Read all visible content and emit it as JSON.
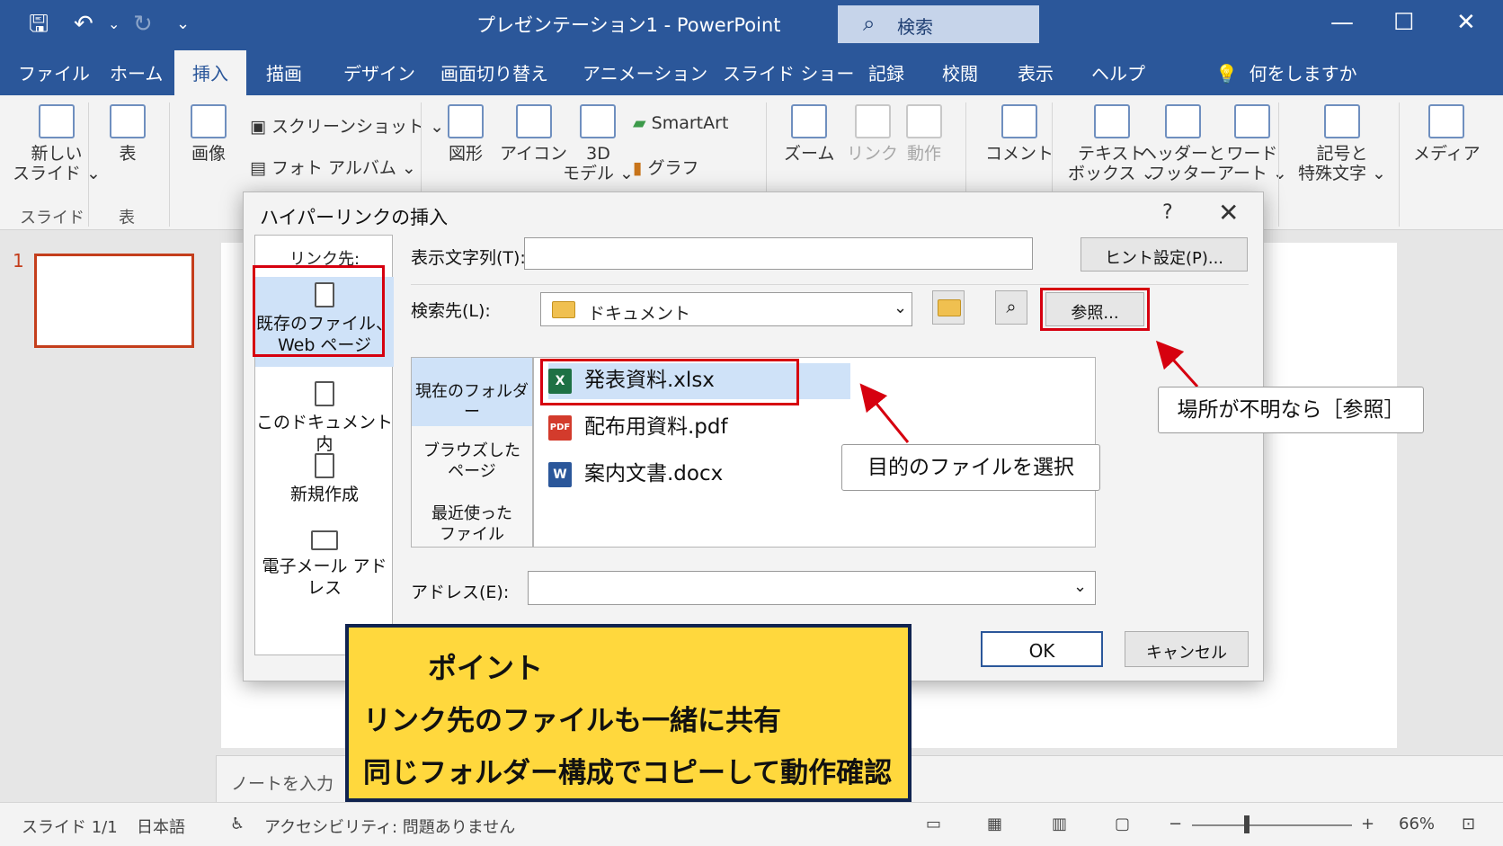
{
  "app": {
    "title": "プレゼンテーション1  -  PowerPoint",
    "search_placeholder": "検索",
    "tell_me": "何をしますか"
  },
  "tabs": [
    "ファイル",
    "ホーム",
    "挿入",
    "描画",
    "デザイン",
    "画面切り替え",
    "アニメーション",
    "スライド ショー",
    "記録",
    "校閲",
    "表示",
    "ヘルプ"
  ],
  "active_tab": "挿入",
  "ribbon": {
    "new_slide": "新しい\nスライド ⌄",
    "table": "表",
    "image": "画像",
    "screenshot": "スクリーンショット ⌄",
    "photo_album": "フォト アルバム  ⌄",
    "shapes": "図形",
    "icons": "アイコン",
    "model3d": "3D\nモデル ⌄",
    "smartart": "SmartArt",
    "graph": "グラフ",
    "zoom": "ズーム",
    "link": "リンク",
    "action": "動作",
    "comment": "コメント",
    "textbox": "テキスト\nボックス ⌄",
    "header_footer": "ヘッダーと\nフッター",
    "wordart": "ワード\nアート ⌄",
    "symbols": "記号と\n特殊文字 ⌄",
    "media": "メディア",
    "groups": {
      "slides": "スライド",
      "tables": "表"
    }
  },
  "slide_pane": {
    "number": "1"
  },
  "notes_placeholder": "ノートを入力",
  "dialog": {
    "title": "ハイパーリンクの挿入",
    "help": "?",
    "close": "✕",
    "link_to_label": "リンク先:",
    "link_options": [
      "既存のファイル、\nWeb ページ",
      "このドキュメント内",
      "新規作成",
      "電子メール アドレス"
    ],
    "display_text_label": "表示文字列(T):",
    "display_text_value": "",
    "screentip_button": "ヒント設定(P)...",
    "look_in_label": "検索先(L):",
    "look_in_value": "ドキュメント",
    "browse_button": "参照...",
    "nav_items": [
      "現在のフォルダー",
      "ブラウズした\nページ",
      "最近使った\nファイル"
    ],
    "files": [
      {
        "name": "発表資料.xlsx",
        "type": "xlsx",
        "icon": "X"
      },
      {
        "name": "配布用資料.pdf",
        "type": "pdf",
        "icon": "PDF"
      },
      {
        "name": "案内文書.docx",
        "type": "docx",
        "icon": "W"
      }
    ],
    "address_label": "アドレス(E):",
    "address_value": "",
    "ok": "OK",
    "cancel": "キャンセル"
  },
  "annotations": {
    "browse_hint": "場所が不明なら［参照］",
    "select_hint": "目的のファイルを選択",
    "point_title": "ポイント",
    "point_line1": "リンク先のファイルも一緒に共有",
    "point_line2": "同じフォルダー構成でコピーして動作確認"
  },
  "status": {
    "slide": "スライド 1/1",
    "language": "日本語",
    "accessibility": "アクセシビリティ: 問題ありません",
    "zoom": "66%"
  },
  "colors": {
    "accent": "#2b579a",
    "highlight": "#d6000f",
    "point_bg": "#ffd83d"
  },
  "icons": [
    "save-icon",
    "undo-icon",
    "redo-icon",
    "customize-icon",
    "search-icon",
    "minimize-icon",
    "maximize-icon",
    "close-icon",
    "lightbulb-icon",
    "folder-icon",
    "globe-search-icon",
    "excel-file-icon",
    "pdf-file-icon",
    "word-file-icon"
  ]
}
